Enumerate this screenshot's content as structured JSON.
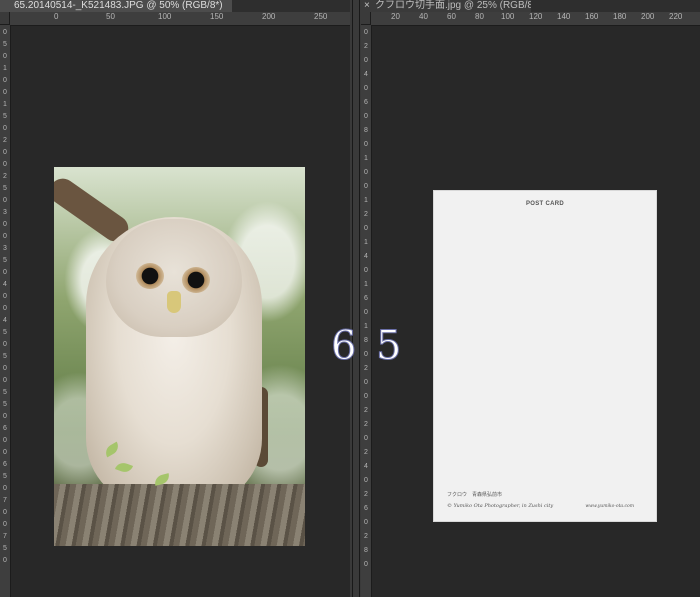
{
  "documents": {
    "left": {
      "tab_title": "65.20140514-_K521483.JPG @ 50% (RGB/8*)",
      "close_glyph": "",
      "ruler_h_labels": [
        "0",
        "50",
        "100",
        "150",
        "200",
        "250"
      ],
      "ruler_v_labels": [
        "0",
        "5",
        "0",
        "1",
        "0",
        "0",
        "1",
        "5",
        "0",
        "2",
        "0",
        "0",
        "2",
        "5",
        "0",
        "3",
        "0",
        "0",
        "3",
        "5",
        "0",
        "4",
        "0",
        "0",
        "4",
        "5",
        "0",
        "5",
        "0",
        "0",
        "5",
        "5",
        "0",
        "6",
        "0",
        "0",
        "6",
        "5",
        "0",
        "7",
        "0",
        "0",
        "7",
        "5",
        "0"
      ]
    },
    "right": {
      "tab_title": "クフロウ切手面.jpg @ 25% (RGB/8)",
      "close_glyph": "×",
      "ruler_h_labels": [
        "20",
        "40",
        "60",
        "80",
        "100",
        "120",
        "140",
        "160",
        "180",
        "200",
        "220"
      ],
      "ruler_v_labels": [
        "0",
        "2",
        "0",
        "4",
        "0",
        "6",
        "0",
        "8",
        "0",
        "1",
        "0",
        "0",
        "1",
        "2",
        "0",
        "1",
        "4",
        "0",
        "1",
        "6",
        "0",
        "1",
        "8",
        "0",
        "2",
        "0",
        "0",
        "2",
        "2",
        "0",
        "2",
        "4",
        "0",
        "2",
        "6",
        "0",
        "2",
        "8",
        "0"
      ]
    }
  },
  "numbers": {
    "left": "6",
    "right": "5"
  },
  "postcard": {
    "title": "POST CARD",
    "line1": "フクロウ　青森県弘前市",
    "line2": "© Yumiko Ota Photographer, in Zushi city",
    "url": "www.yumiko-ota.com"
  },
  "colors": {
    "workspace": "#282828",
    "ruler": "#3e3e3e",
    "active_tab": "#4c4c4c",
    "inactive_tab": "#3a3a3a"
  },
  "icons": {
    "close": "close-icon"
  }
}
